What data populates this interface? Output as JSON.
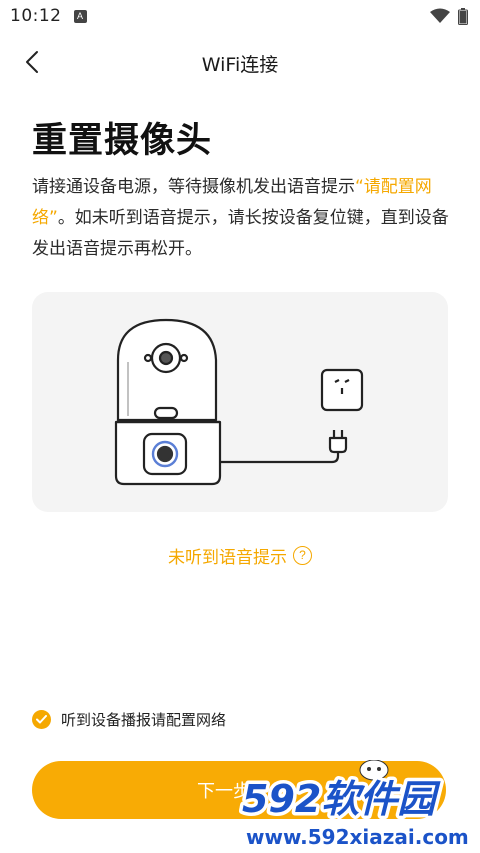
{
  "status_bar": {
    "time": "10:12",
    "notification_icon": "a-icon",
    "wifi_icon": "wifi-icon",
    "battery_icon": "battery-icon"
  },
  "nav": {
    "back_icon": "chevron-left-icon",
    "title": "WiFi连接"
  },
  "main": {
    "title": "重置摄像头",
    "desc_part1": "请接通设备电源，等待摄像机发出语音提示",
    "desc_highlight": "“请配置网络”",
    "desc_part2": "。如未听到语音提示，请长按设备复位键，直到设备发出语音提示再松开。",
    "help_link": "未听到语音提示",
    "help_icon_char": "?",
    "confirm_label": "听到设备播报请配置网络",
    "next_button": "下一步"
  },
  "watermark": {
    "brand": "592软件园",
    "url": "www.592xiazai.com"
  },
  "colors": {
    "accent": "#f5a800",
    "button": "#f8ab05",
    "panel": "#f4f4f4",
    "watermark_blue": "#1b53c8"
  }
}
